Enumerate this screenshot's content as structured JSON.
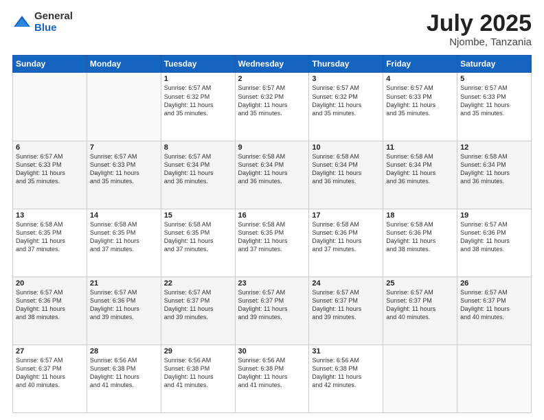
{
  "logo": {
    "general": "General",
    "blue": "Blue"
  },
  "header": {
    "month": "July 2025",
    "location": "Njombe, Tanzania"
  },
  "weekdays": [
    "Sunday",
    "Monday",
    "Tuesday",
    "Wednesday",
    "Thursday",
    "Friday",
    "Saturday"
  ],
  "weeks": [
    [
      {
        "day": "",
        "info": ""
      },
      {
        "day": "",
        "info": ""
      },
      {
        "day": "1",
        "info": "Sunrise: 6:57 AM\nSunset: 6:32 PM\nDaylight: 11 hours\nand 35 minutes."
      },
      {
        "day": "2",
        "info": "Sunrise: 6:57 AM\nSunset: 6:32 PM\nDaylight: 11 hours\nand 35 minutes."
      },
      {
        "day": "3",
        "info": "Sunrise: 6:57 AM\nSunset: 6:32 PM\nDaylight: 11 hours\nand 35 minutes."
      },
      {
        "day": "4",
        "info": "Sunrise: 6:57 AM\nSunset: 6:33 PM\nDaylight: 11 hours\nand 35 minutes."
      },
      {
        "day": "5",
        "info": "Sunrise: 6:57 AM\nSunset: 6:33 PM\nDaylight: 11 hours\nand 35 minutes."
      }
    ],
    [
      {
        "day": "6",
        "info": "Sunrise: 6:57 AM\nSunset: 6:33 PM\nDaylight: 11 hours\nand 35 minutes."
      },
      {
        "day": "7",
        "info": "Sunrise: 6:57 AM\nSunset: 6:33 PM\nDaylight: 11 hours\nand 35 minutes."
      },
      {
        "day": "8",
        "info": "Sunrise: 6:57 AM\nSunset: 6:34 PM\nDaylight: 11 hours\nand 36 minutes."
      },
      {
        "day": "9",
        "info": "Sunrise: 6:58 AM\nSunset: 6:34 PM\nDaylight: 11 hours\nand 36 minutes."
      },
      {
        "day": "10",
        "info": "Sunrise: 6:58 AM\nSunset: 6:34 PM\nDaylight: 11 hours\nand 36 minutes."
      },
      {
        "day": "11",
        "info": "Sunrise: 6:58 AM\nSunset: 6:34 PM\nDaylight: 11 hours\nand 36 minutes."
      },
      {
        "day": "12",
        "info": "Sunrise: 6:58 AM\nSunset: 6:34 PM\nDaylight: 11 hours\nand 36 minutes."
      }
    ],
    [
      {
        "day": "13",
        "info": "Sunrise: 6:58 AM\nSunset: 6:35 PM\nDaylight: 11 hours\nand 37 minutes."
      },
      {
        "day": "14",
        "info": "Sunrise: 6:58 AM\nSunset: 6:35 PM\nDaylight: 11 hours\nand 37 minutes."
      },
      {
        "day": "15",
        "info": "Sunrise: 6:58 AM\nSunset: 6:35 PM\nDaylight: 11 hours\nand 37 minutes."
      },
      {
        "day": "16",
        "info": "Sunrise: 6:58 AM\nSunset: 6:35 PM\nDaylight: 11 hours\nand 37 minutes."
      },
      {
        "day": "17",
        "info": "Sunrise: 6:58 AM\nSunset: 6:36 PM\nDaylight: 11 hours\nand 37 minutes."
      },
      {
        "day": "18",
        "info": "Sunrise: 6:58 AM\nSunset: 6:36 PM\nDaylight: 11 hours\nand 38 minutes."
      },
      {
        "day": "19",
        "info": "Sunrise: 6:57 AM\nSunset: 6:36 PM\nDaylight: 11 hours\nand 38 minutes."
      }
    ],
    [
      {
        "day": "20",
        "info": "Sunrise: 6:57 AM\nSunset: 6:36 PM\nDaylight: 11 hours\nand 38 minutes."
      },
      {
        "day": "21",
        "info": "Sunrise: 6:57 AM\nSunset: 6:36 PM\nDaylight: 11 hours\nand 39 minutes."
      },
      {
        "day": "22",
        "info": "Sunrise: 6:57 AM\nSunset: 6:37 PM\nDaylight: 11 hours\nand 39 minutes."
      },
      {
        "day": "23",
        "info": "Sunrise: 6:57 AM\nSunset: 6:37 PM\nDaylight: 11 hours\nand 39 minutes."
      },
      {
        "day": "24",
        "info": "Sunrise: 6:57 AM\nSunset: 6:37 PM\nDaylight: 11 hours\nand 39 minutes."
      },
      {
        "day": "25",
        "info": "Sunrise: 6:57 AM\nSunset: 6:37 PM\nDaylight: 11 hours\nand 40 minutes."
      },
      {
        "day": "26",
        "info": "Sunrise: 6:57 AM\nSunset: 6:37 PM\nDaylight: 11 hours\nand 40 minutes."
      }
    ],
    [
      {
        "day": "27",
        "info": "Sunrise: 6:57 AM\nSunset: 6:37 PM\nDaylight: 11 hours\nand 40 minutes."
      },
      {
        "day": "28",
        "info": "Sunrise: 6:56 AM\nSunset: 6:38 PM\nDaylight: 11 hours\nand 41 minutes."
      },
      {
        "day": "29",
        "info": "Sunrise: 6:56 AM\nSunset: 6:38 PM\nDaylight: 11 hours\nand 41 minutes."
      },
      {
        "day": "30",
        "info": "Sunrise: 6:56 AM\nSunset: 6:38 PM\nDaylight: 11 hours\nand 41 minutes."
      },
      {
        "day": "31",
        "info": "Sunrise: 6:56 AM\nSunset: 6:38 PM\nDaylight: 11 hours\nand 42 minutes."
      },
      {
        "day": "",
        "info": ""
      },
      {
        "day": "",
        "info": ""
      }
    ]
  ]
}
